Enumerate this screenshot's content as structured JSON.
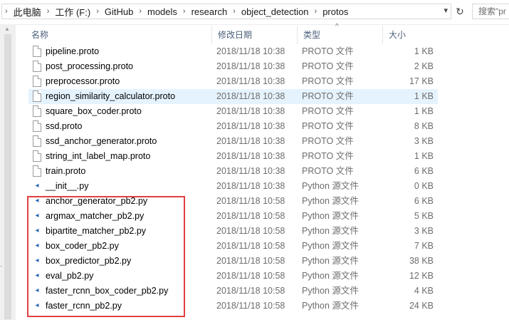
{
  "breadcrumb": {
    "items": [
      "此电脑",
      "工作 (F:)",
      "GitHub",
      "models",
      "research",
      "object_detection",
      "protos"
    ]
  },
  "search": {
    "placeholder": "搜索\"pr"
  },
  "headers": {
    "name": "名称",
    "date": "修改日期",
    "type": "类型",
    "size": "大小"
  },
  "files": [
    {
      "name": "pipeline.proto",
      "date": "2018/11/18 10:38",
      "type": "PROTO 文件",
      "size": "1 KB",
      "icon": "document-icon"
    },
    {
      "name": "post_processing.proto",
      "date": "2018/11/18 10:38",
      "type": "PROTO 文件",
      "size": "2 KB",
      "icon": "document-icon"
    },
    {
      "name": "preprocessor.proto",
      "date": "2018/11/18 10:38",
      "type": "PROTO 文件",
      "size": "17 KB",
      "icon": "document-icon"
    },
    {
      "name": "region_similarity_calculator.proto",
      "date": "2018/11/18 10:38",
      "type": "PROTO 文件",
      "size": "1 KB",
      "icon": "document-icon",
      "selected": true
    },
    {
      "name": "square_box_coder.proto",
      "date": "2018/11/18 10:38",
      "type": "PROTO 文件",
      "size": "1 KB",
      "icon": "document-icon"
    },
    {
      "name": "ssd.proto",
      "date": "2018/11/18 10:38",
      "type": "PROTO 文件",
      "size": "8 KB",
      "icon": "document-icon"
    },
    {
      "name": "ssd_anchor_generator.proto",
      "date": "2018/11/18 10:38",
      "type": "PROTO 文件",
      "size": "3 KB",
      "icon": "document-icon"
    },
    {
      "name": "string_int_label_map.proto",
      "date": "2018/11/18 10:38",
      "type": "PROTO 文件",
      "size": "1 KB",
      "icon": "document-icon"
    },
    {
      "name": "train.proto",
      "date": "2018/11/18 10:38",
      "type": "PROTO 文件",
      "size": "6 KB",
      "icon": "document-icon"
    },
    {
      "name": "__init__.py",
      "date": "2018/11/18 10:38",
      "type": "Python 源文件",
      "size": "0 KB",
      "icon": "python-file-icon"
    },
    {
      "name": "anchor_generator_pb2.py",
      "date": "2018/11/18 10:58",
      "type": "Python 源文件",
      "size": "6 KB",
      "icon": "python-file-icon"
    },
    {
      "name": "argmax_matcher_pb2.py",
      "date": "2018/11/18 10:58",
      "type": "Python 源文件",
      "size": "5 KB",
      "icon": "python-file-icon"
    },
    {
      "name": "bipartite_matcher_pb2.py",
      "date": "2018/11/18 10:58",
      "type": "Python 源文件",
      "size": "3 KB",
      "icon": "python-file-icon"
    },
    {
      "name": "box_coder_pb2.py",
      "date": "2018/11/18 10:58",
      "type": "Python 源文件",
      "size": "7 KB",
      "icon": "python-file-icon"
    },
    {
      "name": "box_predictor_pb2.py",
      "date": "2018/11/18 10:58",
      "type": "Python 源文件",
      "size": "38 KB",
      "icon": "python-file-icon"
    },
    {
      "name": "eval_pb2.py",
      "date": "2018/11/18 10:58",
      "type": "Python 源文件",
      "size": "12 KB",
      "icon": "python-file-icon"
    },
    {
      "name": "faster_rcnn_box_coder_pb2.py",
      "date": "2018/11/18 10:58",
      "type": "Python 源文件",
      "size": "4 KB",
      "icon": "python-file-icon"
    },
    {
      "name": "faster_rcnn_pb2.py",
      "date": "2018/11/18 10:58",
      "type": "Python 源文件",
      "size": "24 KB",
      "icon": "python-file-icon"
    }
  ],
  "colors": {
    "highlight_box": "#e04040",
    "selection": "#e5f3ff"
  }
}
